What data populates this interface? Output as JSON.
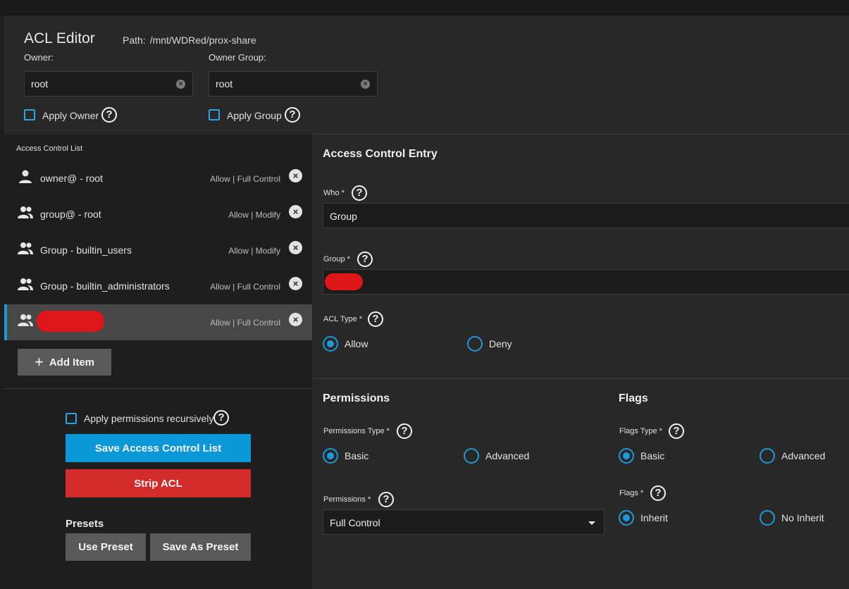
{
  "header": {
    "title": "ACL Editor",
    "path_label": "Path:",
    "path_value": "/mnt/WDRed/prox-share",
    "owner_label": "Owner:",
    "owner_value": "root",
    "owner_group_label": "Owner Group:",
    "owner_group_value": "root",
    "apply_owner_label": "Apply Owner",
    "apply_group_label": "Apply Group"
  },
  "acl": {
    "title": "Access Control List",
    "items": [
      {
        "name": "owner@ - root",
        "perm": "Allow | Full Control",
        "icon": "person-icon"
      },
      {
        "name": "group@ - root",
        "perm": "Allow | Modify",
        "icon": "group-icon"
      },
      {
        "name": "Group - builtin_users",
        "perm": "Allow | Modify",
        "icon": "group-icon"
      },
      {
        "name": "Group - builtin_administrators",
        "perm": "Allow | Full Control",
        "icon": "group-icon"
      },
      {
        "name": "",
        "perm": "Allow | Full Control",
        "icon": "group-icon",
        "selected": true
      }
    ],
    "add_item_label": "Add Item"
  },
  "actions": {
    "recursive_label": "Apply permissions recursively",
    "save_label": "Save Access Control List",
    "strip_label": "Strip ACL",
    "presets_label": "Presets",
    "use_preset_label": "Use Preset",
    "save_as_preset_label": "Save As Preset"
  },
  "entry": {
    "title": "Access Control Entry",
    "who_label": "Who *",
    "who_value": "Group",
    "group_label": "Group *",
    "acl_type_label": "ACL Type *",
    "allow_label": "Allow",
    "deny_label": "Deny"
  },
  "permissions": {
    "title": "Permissions",
    "type_label": "Permissions Type *",
    "basic_label": "Basic",
    "advanced_label": "Advanced",
    "perm_label": "Permissions *",
    "perm_value": "Full Control"
  },
  "flags": {
    "title": "Flags",
    "type_label": "Flags Type *",
    "basic_label": "Basic",
    "advanced_label": "Advanced",
    "flags_label": "Flags *",
    "inherit_label": "Inherit",
    "no_inherit_label": "No Inherit"
  },
  "colors": {
    "accent": "#1e98d7",
    "save_button": "#0b98d8",
    "strip_button": "#d32a2a",
    "redaction": "#e0161a"
  }
}
